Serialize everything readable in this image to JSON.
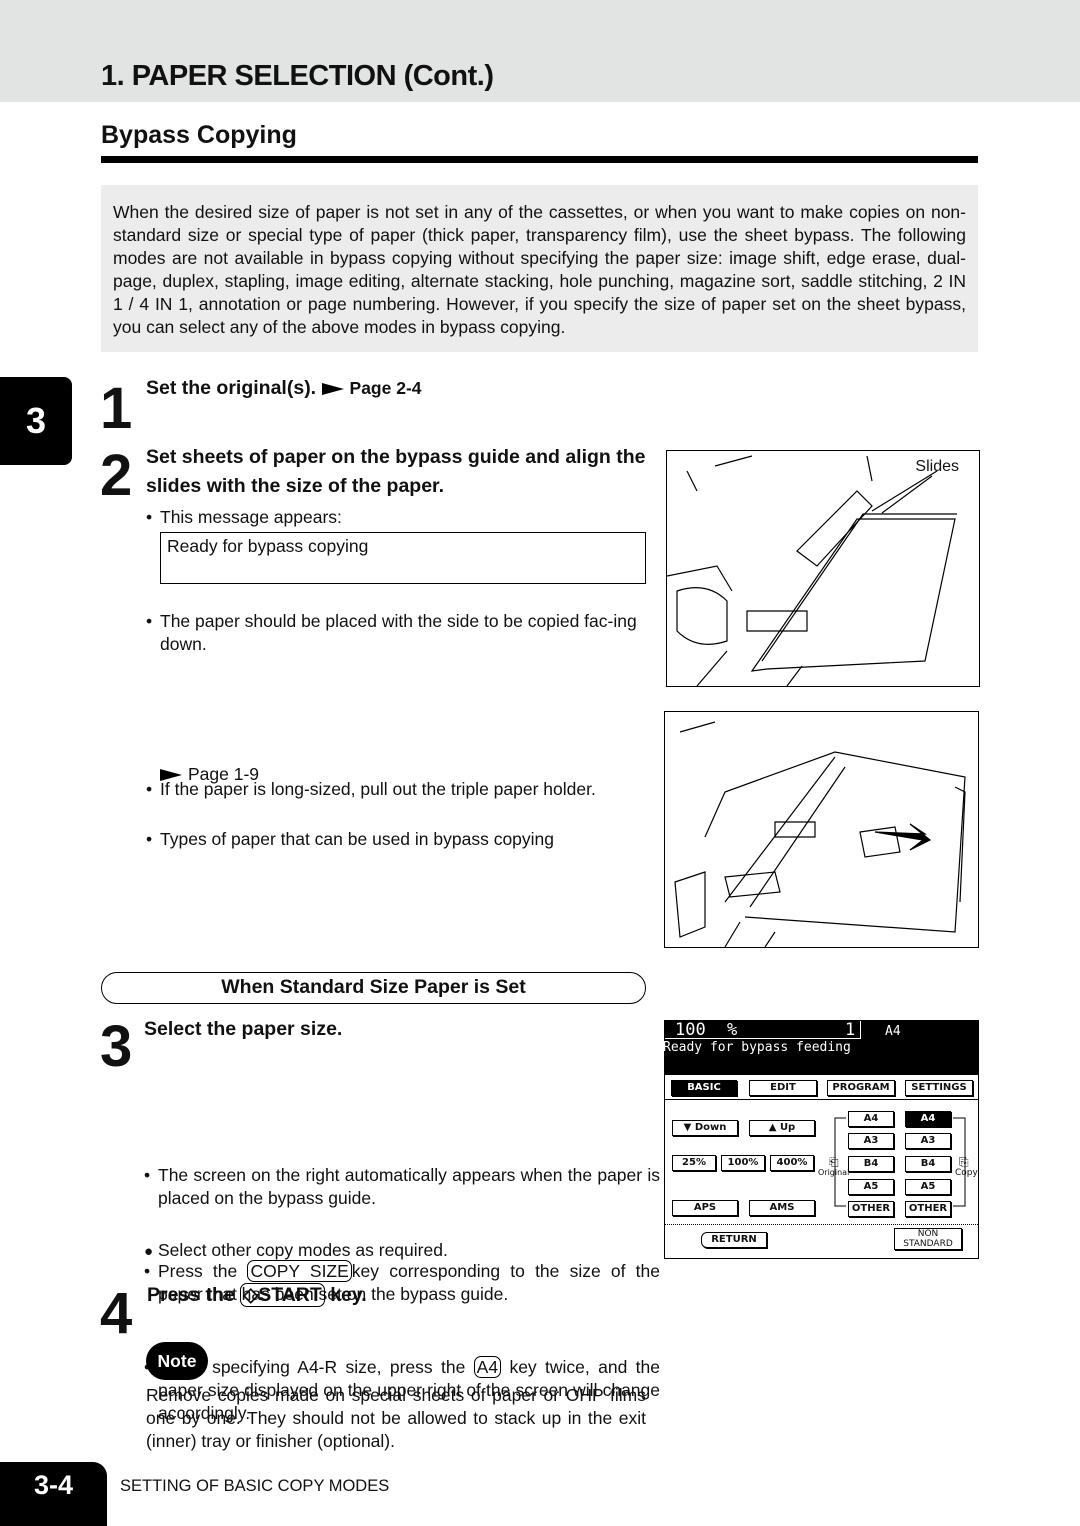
{
  "header": {
    "title": "1. PAPER SELECTION (Cont.)",
    "subtitle": "Bypass Copying"
  },
  "intro": "When the desired size of paper is not set in any of the cassettes, or when you want to make copies on non-standard size or special type of paper (thick paper, transparency film), use the sheet bypass. The following modes are not available in bypass copying without specifying the paper size: image shift, edge erase, dual-page, duplex, stapling, image editing, alternate stacking, hole punching, magazine sort, saddle stitching, 2 IN 1 / 4 IN 1, annotation or page numbering. However, if you specify the size of paper set on the sheet bypass, you can select any of the above modes in bypass copying.",
  "chapter_tab": "3",
  "step1": {
    "num": "1",
    "text": "Set the original(s).",
    "ref": "Page 2-4"
  },
  "step2": {
    "num": "2",
    "text": "Set sheets of paper on the  bypass guide and align the slides with the size of the paper.",
    "b1": "This message appears:",
    "message": "Ready for bypass copying",
    "b2": "The paper should be placed with the side to be copied fac-ing down.",
    "b3": "If the paper is long-sized, pull out the triple paper holder.",
    "b4": "Types of paper that can be used in bypass copying",
    "ref": "Page 1-9",
    "fig_label": "Slides"
  },
  "section_label": "When Standard Size Paper is Set",
  "step3": {
    "num": "3",
    "text": "Select the paper size.",
    "b1": "The screen on the right automatically appears when the paper is placed on the bypass guide.",
    "b2_pre": "Press the",
    "b2_key": "COPY SIZE",
    "b2_post": "key corresponding to the size of the paper that has been set on the bypass guide.",
    "b3_pre": "When specifying A4-R size, press the",
    "b3_key": "A4",
    "b3_post": "key twice, and the paper size displayed on the upper right of the screen will change accordingly.",
    "b4": "Select other copy modes as required."
  },
  "lcd": {
    "zoom": "100",
    "pct": "%",
    "count": "1",
    "size": "A4",
    "status": "Ready for bypass feeding",
    "tabs": [
      "BASIC",
      "EDIT",
      "PROGRAM",
      "SETTINGS"
    ],
    "down": "Down",
    "up": "Up",
    "ratios": [
      "25%",
      "100%",
      "400%"
    ],
    "aps": "APS",
    "ams": "AMS",
    "original_label": "Original",
    "copy_label": "Copy",
    "original_sizes": [
      "A4",
      "A3",
      "B4",
      "A5",
      "OTHER"
    ],
    "copy_sizes": [
      "A4",
      "A3",
      "B4",
      "A5",
      "OTHER"
    ],
    "return": "RETURN",
    "nonstd1": "NON",
    "nonstd2": "STANDARD"
  },
  "step4": {
    "num": "4",
    "pre": "Press the",
    "key": "START",
    "post": "key."
  },
  "note": {
    "label": "Note",
    "text": "Remove copies made on special sheets of paper or OHP films one by one. They should not be allowed to stack up in the exit (inner) tray or finisher (optional)."
  },
  "footer": {
    "page": "3-4",
    "section": "SETTING OF BASIC COPY MODES"
  }
}
